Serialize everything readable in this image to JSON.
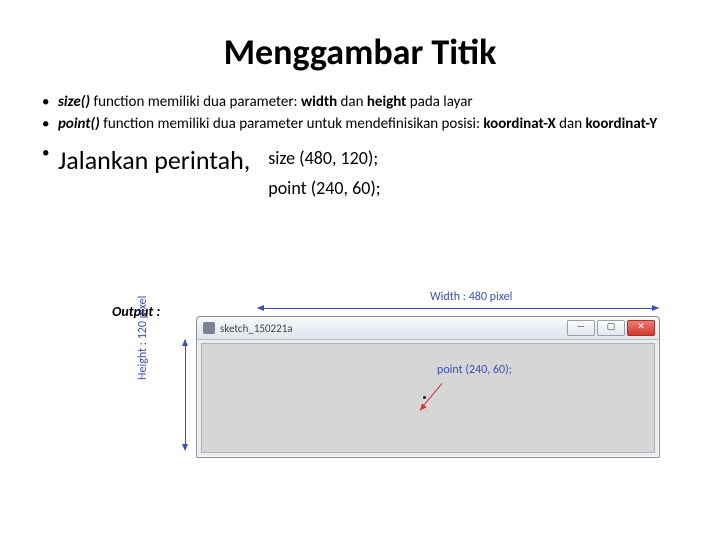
{
  "title": "Menggambar Titik",
  "bullets": {
    "b1": {
      "kw": "size()",
      "mid": " function memiliki dua parameter: ",
      "p1": "width",
      "and": " dan ",
      "p2": "height",
      "tail": " pada layar"
    },
    "b2": {
      "kw": "point()",
      "mid": " function memiliki dua parameter untuk mendefinisikan posisi: ",
      "p1": "koordinat-X",
      "and": " dan ",
      "p2": "koordinat-Y"
    }
  },
  "run_label": "Jalankan perintah,",
  "code": {
    "line1": "size (480, 120);",
    "line2": "point (240, 60);"
  },
  "output_label": "Output :",
  "figure": {
    "width_label": "Width : 480 pixel",
    "height_label": "Height : 120 pixel",
    "window_title": "sketch_150221a",
    "point_label": "point (240, 60);",
    "win_min": "—",
    "win_max": "▢",
    "win_close": "✕"
  }
}
